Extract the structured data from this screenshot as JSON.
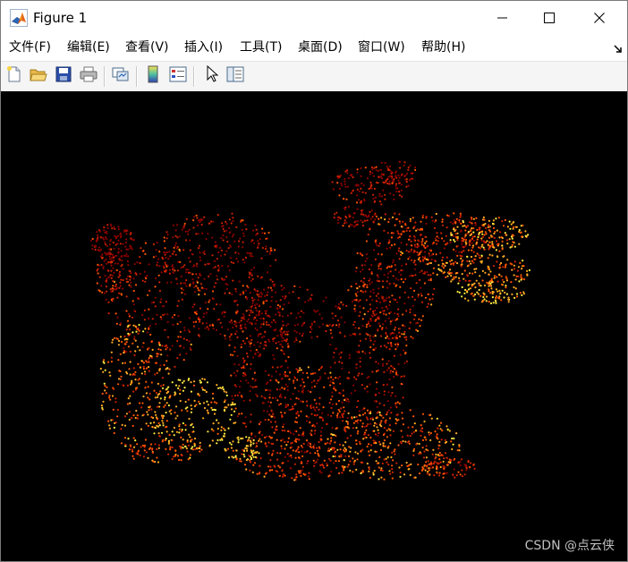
{
  "window": {
    "title": "Figure 1",
    "app_icon": "matlab-icon",
    "controls": {
      "minimize_icon": "minimize-icon",
      "maximize_icon": "maximize-icon",
      "close_icon": "close-icon"
    }
  },
  "menubar": {
    "items": [
      {
        "label": "文件(F)"
      },
      {
        "label": "编辑(E)"
      },
      {
        "label": "查看(V)"
      },
      {
        "label": "插入(I)"
      },
      {
        "label": "工具(T)"
      },
      {
        "label": "桌面(D)"
      },
      {
        "label": "窗口(W)"
      },
      {
        "label": "帮助(H)"
      }
    ],
    "dock_icon": "dock-arrow-icon"
  },
  "toolbar": {
    "buttons": [
      {
        "icon": "new-figure-icon"
      },
      {
        "icon": "open-file-icon"
      },
      {
        "icon": "save-icon"
      },
      {
        "icon": "print-icon"
      },
      {
        "icon": "link-plot-icon"
      },
      {
        "icon": "insert-colorbar-icon"
      },
      {
        "icon": "insert-legend-icon"
      },
      {
        "icon": "edit-plot-pointer-icon"
      },
      {
        "icon": "property-inspector-icon"
      }
    ]
  },
  "plot": {
    "background": "#000000",
    "colormap": [
      "#8b0000",
      "#cc2200",
      "#ff5500",
      "#ffaa22",
      "#ffee44"
    ],
    "subject": "point-cloud-dragon"
  },
  "watermark": {
    "text": "CSDN @点云侠"
  }
}
